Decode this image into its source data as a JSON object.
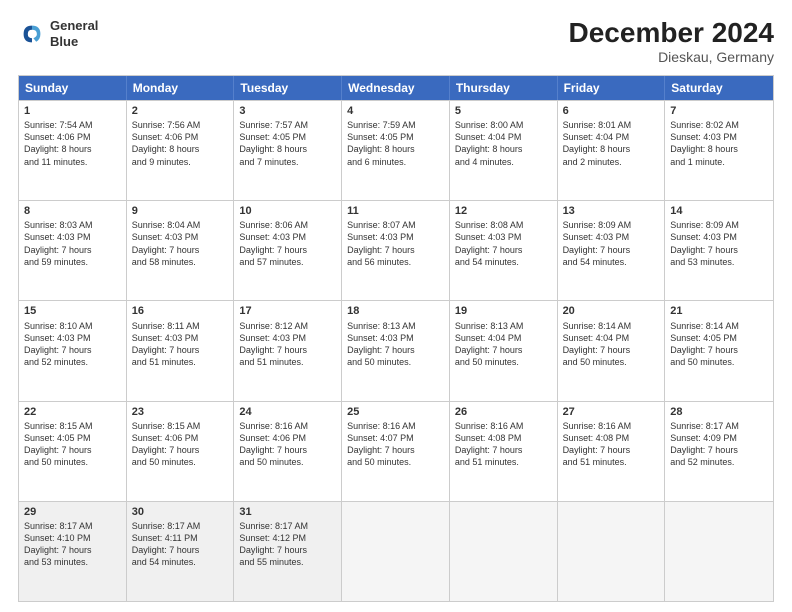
{
  "header": {
    "logo_line1": "General",
    "logo_line2": "Blue",
    "title": "December 2024",
    "subtitle": "Dieskau, Germany"
  },
  "days_of_week": [
    "Sunday",
    "Monday",
    "Tuesday",
    "Wednesday",
    "Thursday",
    "Friday",
    "Saturday"
  ],
  "rows": [
    [
      {
        "day": "1",
        "lines": [
          "Sunrise: 7:54 AM",
          "Sunset: 4:06 PM",
          "Daylight: 8 hours",
          "and 11 minutes."
        ]
      },
      {
        "day": "2",
        "lines": [
          "Sunrise: 7:56 AM",
          "Sunset: 4:06 PM",
          "Daylight: 8 hours",
          "and 9 minutes."
        ]
      },
      {
        "day": "3",
        "lines": [
          "Sunrise: 7:57 AM",
          "Sunset: 4:05 PM",
          "Daylight: 8 hours",
          "and 7 minutes."
        ]
      },
      {
        "day": "4",
        "lines": [
          "Sunrise: 7:59 AM",
          "Sunset: 4:05 PM",
          "Daylight: 8 hours",
          "and 6 minutes."
        ]
      },
      {
        "day": "5",
        "lines": [
          "Sunrise: 8:00 AM",
          "Sunset: 4:04 PM",
          "Daylight: 8 hours",
          "and 4 minutes."
        ]
      },
      {
        "day": "6",
        "lines": [
          "Sunrise: 8:01 AM",
          "Sunset: 4:04 PM",
          "Daylight: 8 hours",
          "and 2 minutes."
        ]
      },
      {
        "day": "7",
        "lines": [
          "Sunrise: 8:02 AM",
          "Sunset: 4:03 PM",
          "Daylight: 8 hours",
          "and 1 minute."
        ]
      }
    ],
    [
      {
        "day": "8",
        "lines": [
          "Sunrise: 8:03 AM",
          "Sunset: 4:03 PM",
          "Daylight: 7 hours",
          "and 59 minutes."
        ]
      },
      {
        "day": "9",
        "lines": [
          "Sunrise: 8:04 AM",
          "Sunset: 4:03 PM",
          "Daylight: 7 hours",
          "and 58 minutes."
        ]
      },
      {
        "day": "10",
        "lines": [
          "Sunrise: 8:06 AM",
          "Sunset: 4:03 PM",
          "Daylight: 7 hours",
          "and 57 minutes."
        ]
      },
      {
        "day": "11",
        "lines": [
          "Sunrise: 8:07 AM",
          "Sunset: 4:03 PM",
          "Daylight: 7 hours",
          "and 56 minutes."
        ]
      },
      {
        "day": "12",
        "lines": [
          "Sunrise: 8:08 AM",
          "Sunset: 4:03 PM",
          "Daylight: 7 hours",
          "and 54 minutes."
        ]
      },
      {
        "day": "13",
        "lines": [
          "Sunrise: 8:09 AM",
          "Sunset: 4:03 PM",
          "Daylight: 7 hours",
          "and 54 minutes."
        ]
      },
      {
        "day": "14",
        "lines": [
          "Sunrise: 8:09 AM",
          "Sunset: 4:03 PM",
          "Daylight: 7 hours",
          "and 53 minutes."
        ]
      }
    ],
    [
      {
        "day": "15",
        "lines": [
          "Sunrise: 8:10 AM",
          "Sunset: 4:03 PM",
          "Daylight: 7 hours",
          "and 52 minutes."
        ]
      },
      {
        "day": "16",
        "lines": [
          "Sunrise: 8:11 AM",
          "Sunset: 4:03 PM",
          "Daylight: 7 hours",
          "and 51 minutes."
        ]
      },
      {
        "day": "17",
        "lines": [
          "Sunrise: 8:12 AM",
          "Sunset: 4:03 PM",
          "Daylight: 7 hours",
          "and 51 minutes."
        ]
      },
      {
        "day": "18",
        "lines": [
          "Sunrise: 8:13 AM",
          "Sunset: 4:03 PM",
          "Daylight: 7 hours",
          "and 50 minutes."
        ]
      },
      {
        "day": "19",
        "lines": [
          "Sunrise: 8:13 AM",
          "Sunset: 4:04 PM",
          "Daylight: 7 hours",
          "and 50 minutes."
        ]
      },
      {
        "day": "20",
        "lines": [
          "Sunrise: 8:14 AM",
          "Sunset: 4:04 PM",
          "Daylight: 7 hours",
          "and 50 minutes."
        ]
      },
      {
        "day": "21",
        "lines": [
          "Sunrise: 8:14 AM",
          "Sunset: 4:05 PM",
          "Daylight: 7 hours",
          "and 50 minutes."
        ]
      }
    ],
    [
      {
        "day": "22",
        "lines": [
          "Sunrise: 8:15 AM",
          "Sunset: 4:05 PM",
          "Daylight: 7 hours",
          "and 50 minutes."
        ]
      },
      {
        "day": "23",
        "lines": [
          "Sunrise: 8:15 AM",
          "Sunset: 4:06 PM",
          "Daylight: 7 hours",
          "and 50 minutes."
        ]
      },
      {
        "day": "24",
        "lines": [
          "Sunrise: 8:16 AM",
          "Sunset: 4:06 PM",
          "Daylight: 7 hours",
          "and 50 minutes."
        ]
      },
      {
        "day": "25",
        "lines": [
          "Sunrise: 8:16 AM",
          "Sunset: 4:07 PM",
          "Daylight: 7 hours",
          "and 50 minutes."
        ]
      },
      {
        "day": "26",
        "lines": [
          "Sunrise: 8:16 AM",
          "Sunset: 4:08 PM",
          "Daylight: 7 hours",
          "and 51 minutes."
        ]
      },
      {
        "day": "27",
        "lines": [
          "Sunrise: 8:16 AM",
          "Sunset: 4:08 PM",
          "Daylight: 7 hours",
          "and 51 minutes."
        ]
      },
      {
        "day": "28",
        "lines": [
          "Sunrise: 8:17 AM",
          "Sunset: 4:09 PM",
          "Daylight: 7 hours",
          "and 52 minutes."
        ]
      }
    ],
    [
      {
        "day": "29",
        "lines": [
          "Sunrise: 8:17 AM",
          "Sunset: 4:10 PM",
          "Daylight: 7 hours",
          "and 53 minutes."
        ]
      },
      {
        "day": "30",
        "lines": [
          "Sunrise: 8:17 AM",
          "Sunset: 4:11 PM",
          "Daylight: 7 hours",
          "and 54 minutes."
        ]
      },
      {
        "day": "31",
        "lines": [
          "Sunrise: 8:17 AM",
          "Sunset: 4:12 PM",
          "Daylight: 7 hours",
          "and 55 minutes."
        ]
      },
      null,
      null,
      null,
      null
    ]
  ]
}
